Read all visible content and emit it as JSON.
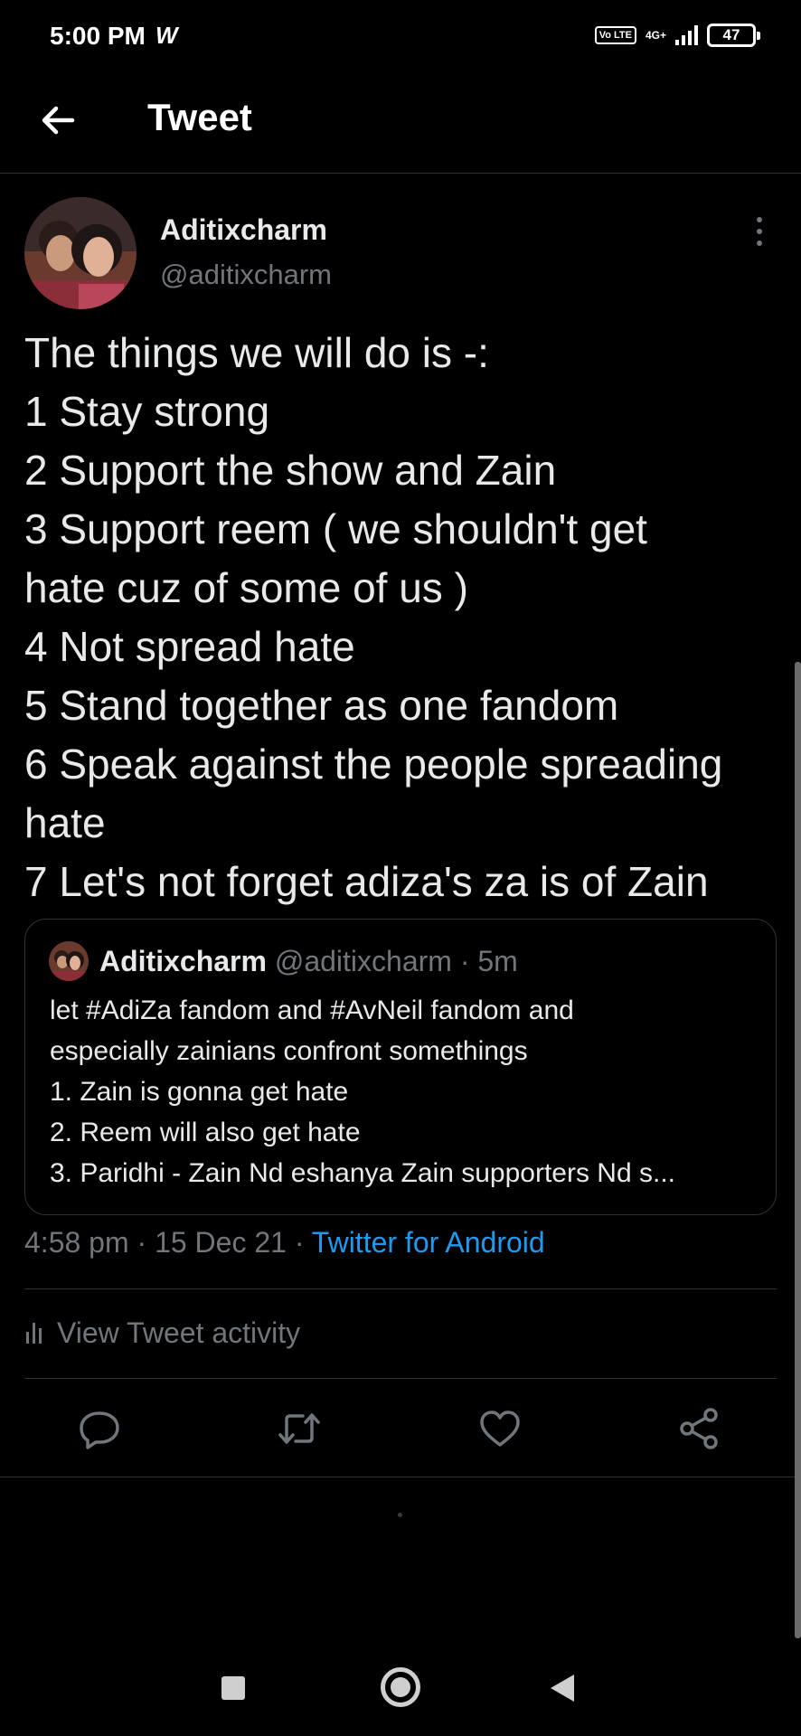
{
  "status_bar": {
    "time": "5:00 PM",
    "carrier_glyph": "W",
    "volte": "Vo LTE",
    "network": "4G+",
    "battery": "47"
  },
  "header": {
    "back_icon": "arrow-left-icon",
    "title": "Tweet"
  },
  "tweet": {
    "author_name": "Aditixcharm",
    "author_handle": "@aditixcharm",
    "lines": [
      "The things we will do is -:",
      "1 Stay strong",
      "2 Support the show and Zain",
      "3 Support reem ( we shouldn't get",
      "hate cuz of some of us )",
      "4 Not spread hate",
      "5 Stand together as one fandom",
      "6 Speak against the people spreading",
      "hate",
      "7 Let's not forget adiza's za is of Zain"
    ],
    "quoted": {
      "author_name": "Aditixcharm",
      "author_handle": "@aditixcharm",
      "separator": "·",
      "time": "5m",
      "lines": [
        "let #AdiZa fandom and #AvNeil  fandom and",
        "especially  zainians  confront somethings",
        "1. Zain is gonna get hate",
        "2. Reem will also get hate",
        "3. Paridhi - Zain Nd eshanya Zain supporters Nd s..."
      ]
    },
    "meta": {
      "time": "4:58 pm",
      "separator": "·",
      "date": "15 Dec 21",
      "source": "Twitter for Android"
    },
    "activity_label": "View Tweet activity"
  },
  "actions": [
    "reply-icon",
    "retweet-icon",
    "like-icon",
    "share-icon"
  ],
  "colors": {
    "background": "#000000",
    "text": "#e7e9ea",
    "muted": "#71767b",
    "link": "#1d9bf0",
    "divider": "#2f3336"
  }
}
